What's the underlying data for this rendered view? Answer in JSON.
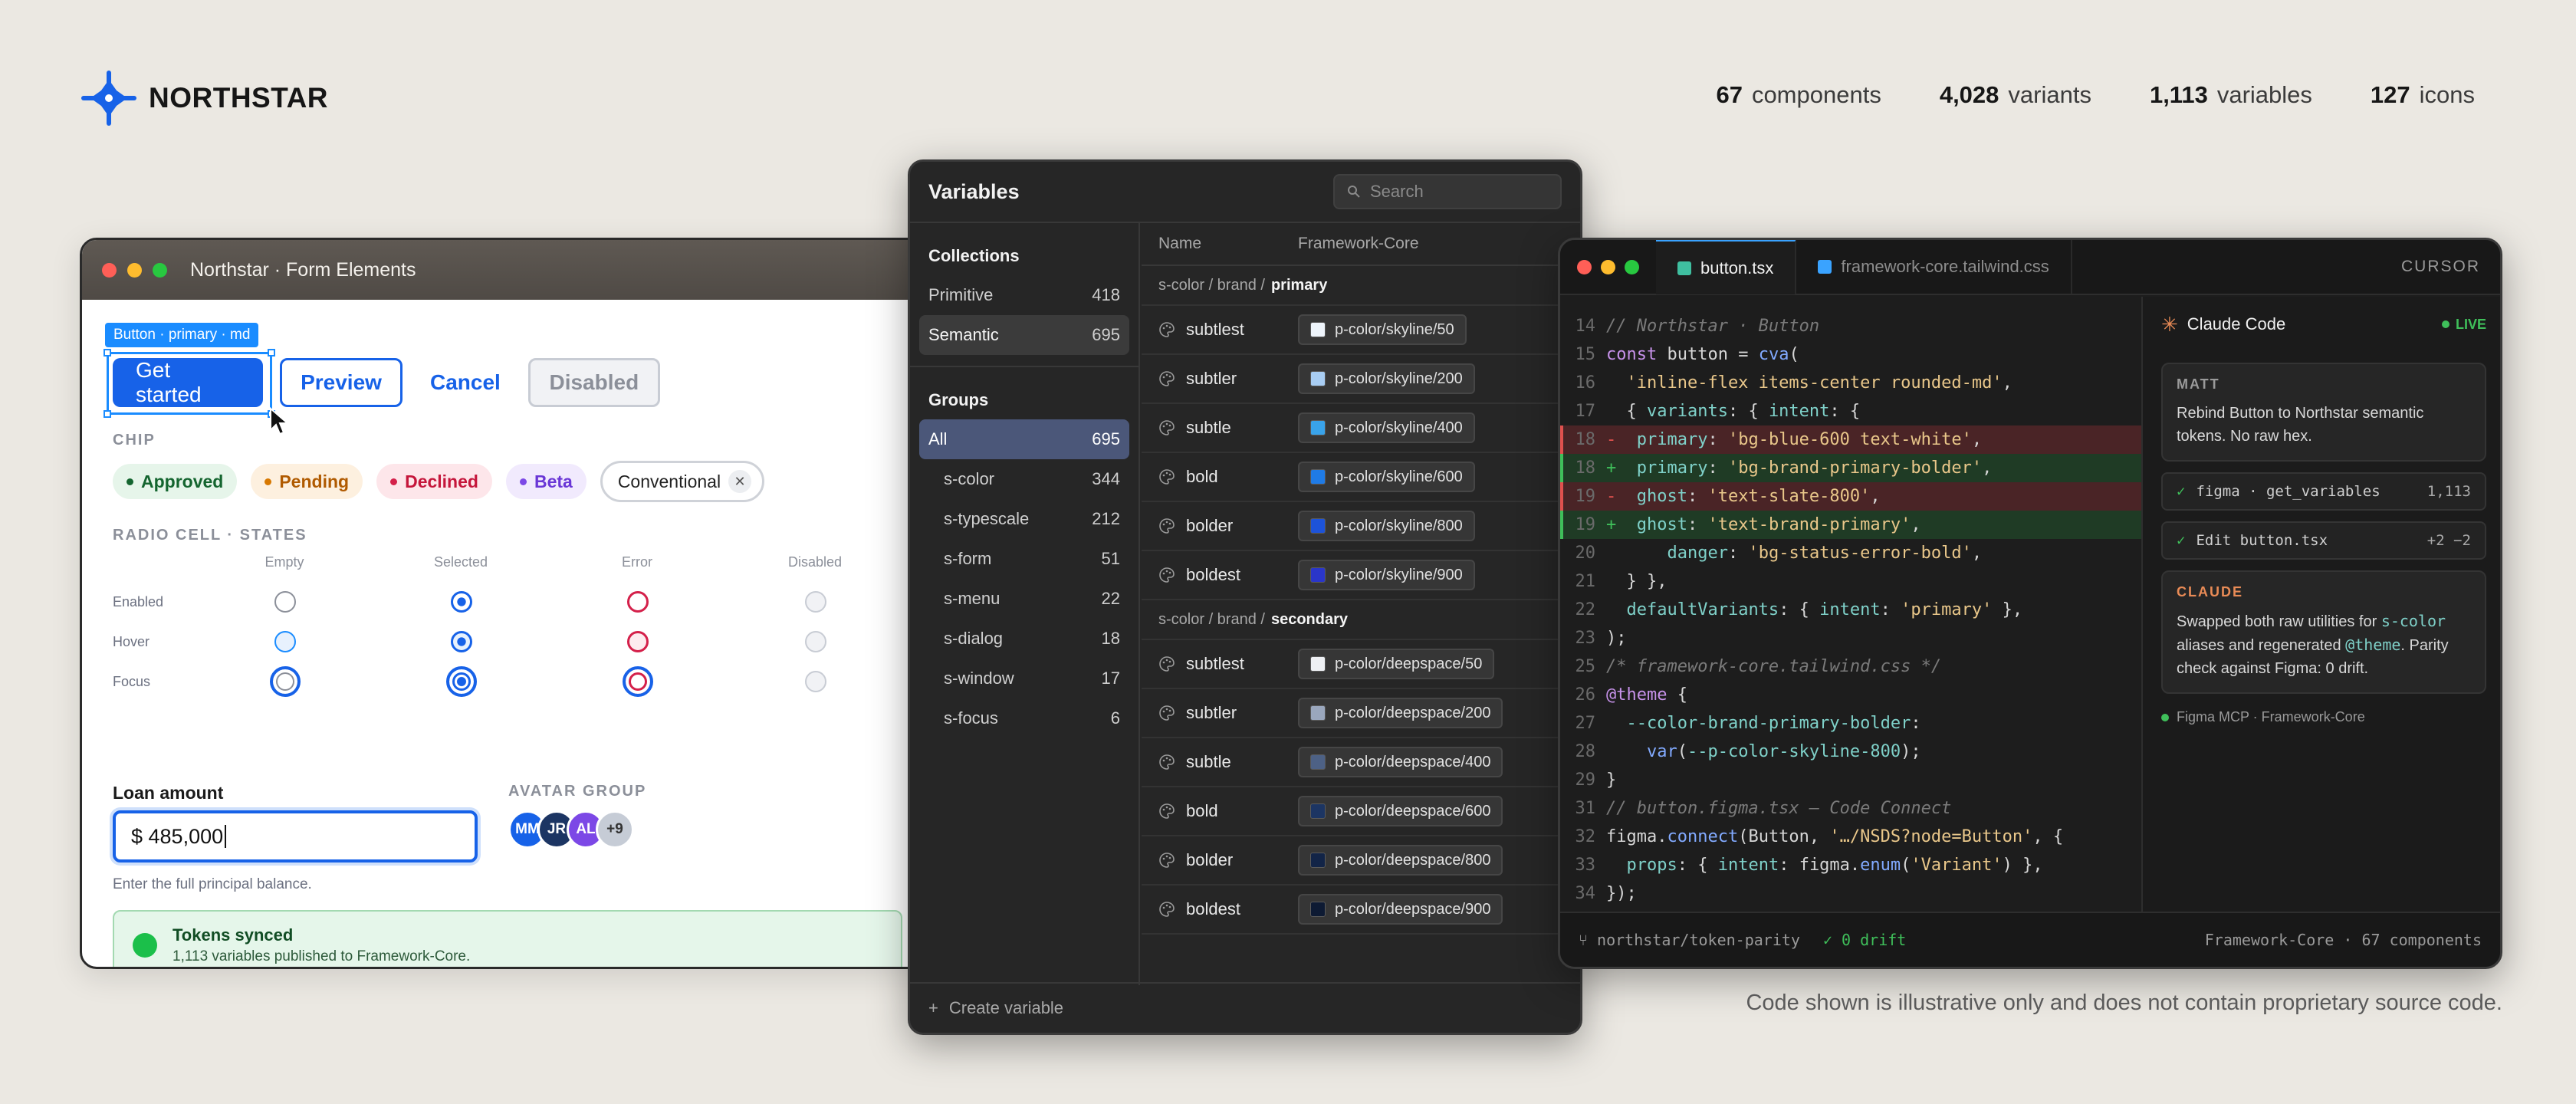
{
  "brand": {
    "name": "NORTHSTAR",
    "color": "#1762e8"
  },
  "stats": [
    {
      "value": "67",
      "label": "components"
    },
    {
      "value": "4,028",
      "label": "variants"
    },
    {
      "value": "1,113",
      "label": "variables"
    },
    {
      "value": "127",
      "label": "icons"
    }
  ],
  "form_window": {
    "title": "Northstar · Form Elements",
    "selection_tag": "Button · primary · md",
    "buttons": {
      "primary": "Get started",
      "outline": "Preview",
      "ghost": "Cancel",
      "disabled": "Disabled"
    },
    "chip_section": "CHIP",
    "chips": {
      "approved": "Approved",
      "pending": "Pending",
      "declined": "Declined",
      "beta": "Beta",
      "conventional": "Conventional"
    },
    "radio_section": "RADIO CELL · STATES",
    "radio_columns": [
      "Empty",
      "Selected",
      "Error",
      "Disabled"
    ],
    "radio_rows": [
      "Enabled",
      "Hover",
      "Focus"
    ],
    "loan": {
      "label": "Loan amount",
      "value": "$ 485,000",
      "help": "Enter the full principal balance."
    },
    "avatar_section": "AVATAR GROUP",
    "avatars": [
      "MM",
      "JR",
      "AL",
      "+9"
    ],
    "toast": {
      "title": "Tokens synced",
      "subtitle": "1,113 variables published to Framework-Core."
    }
  },
  "variables_window": {
    "title": "Variables",
    "search_placeholder": "Search",
    "collections_label": "Collections",
    "collections": [
      {
        "name": "Primitive",
        "count": "418"
      },
      {
        "name": "Semantic",
        "count": "695"
      }
    ],
    "groups_label": "Groups",
    "groups": [
      {
        "name": "All",
        "count": "695"
      },
      {
        "name": "s-color",
        "count": "344"
      },
      {
        "name": "s-typescale",
        "count": "212"
      },
      {
        "name": "s-form",
        "count": "51"
      },
      {
        "name": "s-menu",
        "count": "22"
      },
      {
        "name": "s-dialog",
        "count": "18"
      },
      {
        "name": "s-window",
        "count": "17"
      },
      {
        "name": "s-focus",
        "count": "6"
      }
    ],
    "columns": {
      "name": "Name",
      "mode": "Framework-Core"
    },
    "primary_group": {
      "path": "s-color / brand /",
      "name": "primary"
    },
    "primary_rows": [
      {
        "name": "subtlest",
        "value": "p-color/skyline/50",
        "swatch": "#eef4fb"
      },
      {
        "name": "subtler",
        "value": "p-color/skyline/200",
        "swatch": "#a8cdf3"
      },
      {
        "name": "subtle",
        "value": "p-color/skyline/400",
        "swatch": "#39a3ea"
      },
      {
        "name": "bold",
        "value": "p-color/skyline/600",
        "swatch": "#1f7be6"
      },
      {
        "name": "bolder",
        "value": "p-color/skyline/800",
        "swatch": "#1d53d9"
      },
      {
        "name": "boldest",
        "value": "p-color/skyline/900",
        "swatch": "#2a36c9"
      }
    ],
    "secondary_group": {
      "path": "s-color / brand /",
      "name": "secondary"
    },
    "secondary_rows": [
      {
        "name": "subtlest",
        "value": "p-color/deepspace/50",
        "swatch": "#eef0f4"
      },
      {
        "name": "subtler",
        "value": "p-color/deepspace/200",
        "swatch": "#9aa7bd"
      },
      {
        "name": "subtle",
        "value": "p-color/deepspace/400",
        "swatch": "#4d6185"
      },
      {
        "name": "bold",
        "value": "p-color/deepspace/600",
        "swatch": "#1c3563"
      },
      {
        "name": "bolder",
        "value": "p-color/deepspace/800",
        "swatch": "#122447"
      },
      {
        "name": "boldest",
        "value": "p-color/deepspace/900",
        "swatch": "#0d1a33"
      }
    ],
    "footer": "Create variable"
  },
  "code_window": {
    "tabs": [
      {
        "label": "button.tsx",
        "color": "#3fbfa0"
      },
      {
        "label": "framework-core.tailwind.css",
        "color": "#3aa3ff"
      }
    ],
    "app_label": "CURSOR",
    "lines": [
      {
        "n": "14",
        "t": "",
        "parts": [
          [
            "com",
            "// Northstar · Button"
          ]
        ]
      },
      {
        "n": "15",
        "t": "",
        "parts": [
          [
            "kw",
            "const "
          ],
          [
            "pl",
            "button = "
          ],
          [
            "fn",
            "cva"
          ],
          [
            "pl",
            "("
          ]
        ]
      },
      {
        "n": "16",
        "t": "",
        "parts": [
          [
            "str",
            "  'inline-flex items-center rounded-md'"
          ],
          [
            "pl",
            ","
          ]
        ]
      },
      {
        "n": "17",
        "t": "",
        "parts": [
          [
            "pl",
            "  { "
          ],
          [
            "prop",
            "variants"
          ],
          [
            "pl",
            ": { "
          ],
          [
            "prop",
            "intent"
          ],
          [
            "pl",
            ": {"
          ]
        ]
      },
      {
        "n": "18",
        "t": "del",
        "parts": [
          [
            "mark",
            "-  "
          ],
          [
            "prop",
            "primary"
          ],
          [
            "pl",
            ": "
          ],
          [
            "str",
            "'bg-blue-600 text-white'"
          ],
          [
            "pl",
            ","
          ]
        ]
      },
      {
        "n": "18",
        "t": "add",
        "parts": [
          [
            "plus",
            "+  "
          ],
          [
            "prop",
            "primary"
          ],
          [
            "pl",
            ": "
          ],
          [
            "str",
            "'bg-brand-primary-bolder'"
          ],
          [
            "pl",
            ","
          ]
        ]
      },
      {
        "n": "19",
        "t": "del",
        "parts": [
          [
            "mark",
            "-  "
          ],
          [
            "prop",
            "ghost"
          ],
          [
            "pl",
            ": "
          ],
          [
            "str",
            "'text-slate-800'"
          ],
          [
            "pl",
            ","
          ]
        ]
      },
      {
        "n": "19",
        "t": "add",
        "parts": [
          [
            "plus",
            "+  "
          ],
          [
            "prop",
            "ghost"
          ],
          [
            "pl",
            ": "
          ],
          [
            "str",
            "'text-brand-primary'"
          ],
          [
            "pl",
            ","
          ]
        ]
      },
      {
        "n": "20",
        "t": "",
        "parts": [
          [
            "pl",
            "      "
          ],
          [
            "prop",
            "danger"
          ],
          [
            "pl",
            ": "
          ],
          [
            "str",
            "'bg-status-error-bold'"
          ],
          [
            "pl",
            ","
          ]
        ]
      },
      {
        "n": "21",
        "t": "",
        "parts": [
          [
            "pl",
            "  } },"
          ]
        ]
      },
      {
        "n": "22",
        "t": "",
        "parts": [
          [
            "pl",
            "  "
          ],
          [
            "prop",
            "defaultVariants"
          ],
          [
            "pl",
            ": { "
          ],
          [
            "prop",
            "intent"
          ],
          [
            "pl",
            ": "
          ],
          [
            "str",
            "'primary'"
          ],
          [
            "pl",
            " },"
          ]
        ]
      },
      {
        "n": "23",
        "t": "",
        "parts": [
          [
            "pl",
            ");"
          ]
        ]
      },
      {
        "n": "25",
        "t": "",
        "parts": [
          [
            "com",
            "/* framework-core.tailwind.css */"
          ]
        ]
      },
      {
        "n": "26",
        "t": "",
        "parts": [
          [
            "kw",
            "@theme"
          ],
          [
            "pl",
            " {"
          ]
        ]
      },
      {
        "n": "27",
        "t": "",
        "parts": [
          [
            "prop",
            "  --color-brand-primary-bolder"
          ],
          [
            "pl",
            ":"
          ]
        ]
      },
      {
        "n": "28",
        "t": "",
        "parts": [
          [
            "pl",
            "    "
          ],
          [
            "fn",
            "var"
          ],
          [
            "pl",
            "("
          ],
          [
            "prop",
            "--p-color-skyline-800"
          ],
          [
            "pl",
            ");"
          ]
        ]
      },
      {
        "n": "29",
        "t": "",
        "parts": [
          [
            "pl",
            "}"
          ]
        ]
      },
      {
        "n": "31",
        "t": "",
        "parts": [
          [
            "com",
            "// button.figma.tsx — Code Connect"
          ]
        ]
      },
      {
        "n": "32",
        "t": "",
        "parts": [
          [
            "pl",
            "figma."
          ],
          [
            "fn",
            "connect"
          ],
          [
            "pl",
            "(Button, "
          ],
          [
            "str",
            "'…/NSDS?node=Button'"
          ],
          [
            "pl",
            ", {"
          ]
        ]
      },
      {
        "n": "33",
        "t": "",
        "parts": [
          [
            "pl",
            "  "
          ],
          [
            "prop",
            "props"
          ],
          [
            "pl",
            ": { "
          ],
          [
            "prop",
            "intent"
          ],
          [
            "pl",
            ": figma."
          ],
          [
            "fn",
            "enum"
          ],
          [
            "pl",
            "("
          ],
          [
            "str",
            "'Variant'"
          ],
          [
            "pl",
            ") },"
          ]
        ]
      },
      {
        "n": "34",
        "t": "",
        "parts": [
          [
            "pl",
            "});"
          ]
        ]
      }
    ],
    "panel": {
      "title": "Claude Code",
      "status": "LIVE",
      "user_name": "MATT",
      "user_msg": "Rebind Button to Northstar semantic tokens. No raw hex.",
      "tool1": {
        "name": "figma · get_variables",
        "count": "1,113"
      },
      "tool2": {
        "name": "Edit button.tsx",
        "count": "+2 −2"
      },
      "assistant_name": "CLAUDE",
      "assistant_msg_1": "Swapped both raw utilities for ",
      "assistant_hl_1": "s-color",
      "assistant_msg_2": " aliases and regenerated ",
      "assistant_hl_2": "@theme",
      "assistant_msg_3": ". Parity check against Figma: 0 drift.",
      "mcp": "Figma MCP · Framework-Core"
    },
    "footer": {
      "branch": "northstar/token-parity",
      "drift": "✓ 0 drift",
      "right": "Framework-Core · 67 components"
    }
  },
  "disclaimer": "Code shown is illustrative only and does not contain proprietary source code."
}
